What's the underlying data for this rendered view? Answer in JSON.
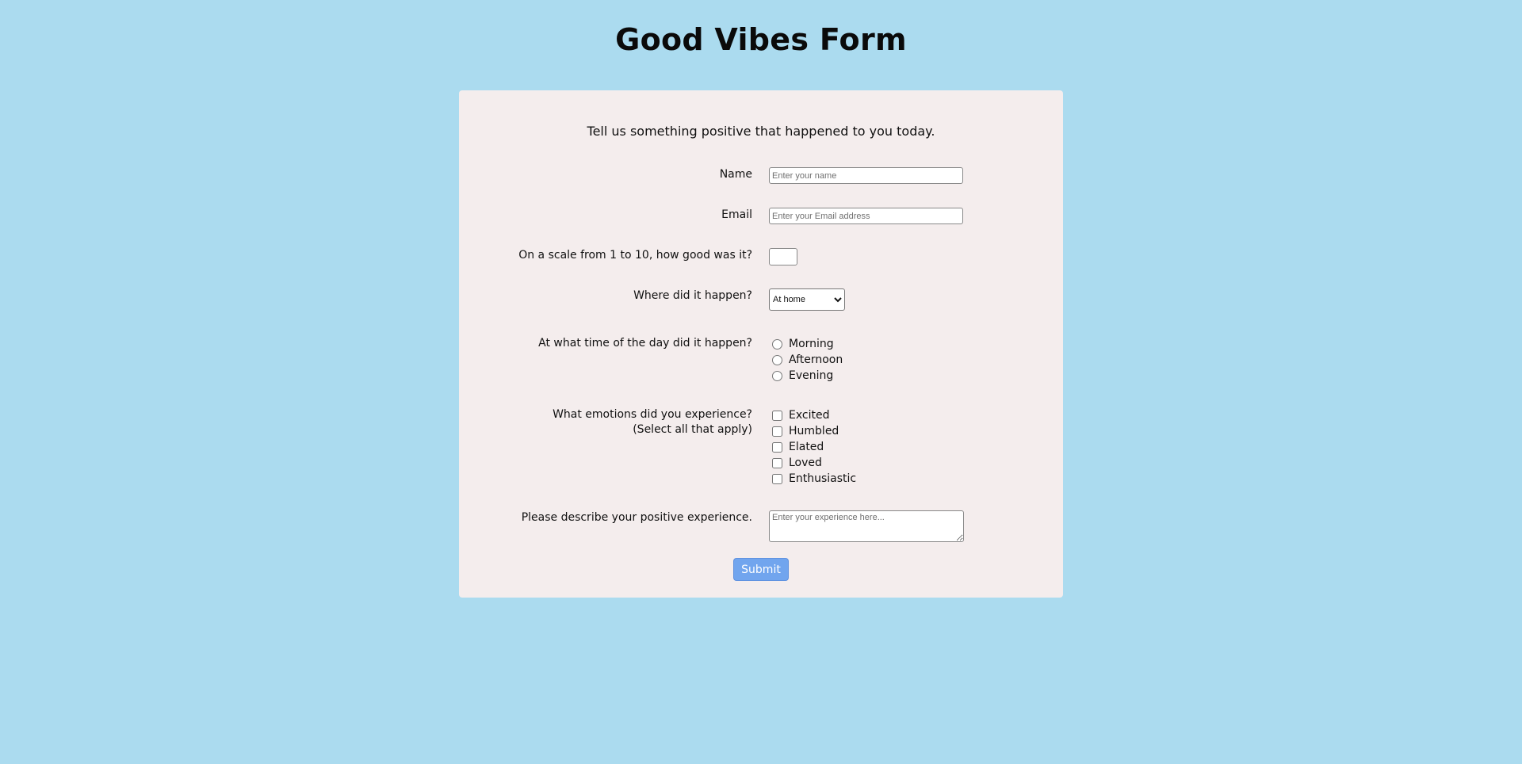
{
  "page": {
    "title": "Good Vibes Form",
    "background_color": "#abdbef",
    "card_color": "#f4eded",
    "accent_color": "#71a5ee"
  },
  "form": {
    "intro": "Tell us something positive that happened to you today.",
    "name": {
      "label": "Name",
      "value": "",
      "placeholder": "Enter your name"
    },
    "email": {
      "label": "Email",
      "value": "",
      "placeholder": "Enter your Email address"
    },
    "scale": {
      "label": "On a scale from 1 to 10, how good was it?",
      "value": ""
    },
    "location": {
      "label": "Where did it happen?",
      "selected": "At home"
    },
    "time_of_day": {
      "label": "At what time of the day did it happen?",
      "options": [
        "Morning",
        "Afternoon",
        "Evening"
      ]
    },
    "emotions": {
      "label_line1": "What emotions did you experience?",
      "label_line2": "(Select all that apply)",
      "options": [
        "Excited",
        "Humbled",
        "Elated",
        "Loved",
        "Enthusiastic"
      ]
    },
    "experience": {
      "label": "Please describe your positive experience.",
      "value": "",
      "placeholder": "Enter your experience here..."
    },
    "submit_label": "Submit"
  }
}
